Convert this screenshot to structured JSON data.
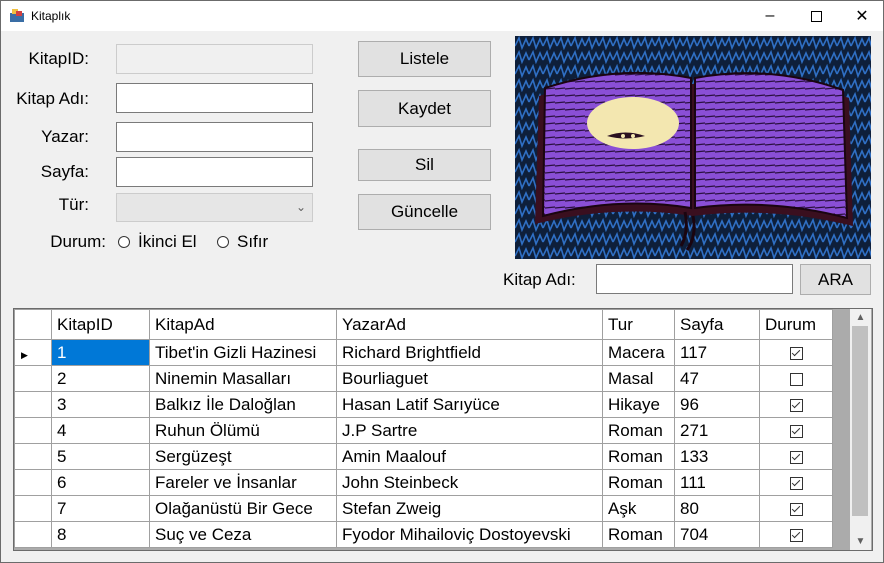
{
  "window": {
    "title": "Kitaplık"
  },
  "form": {
    "labels": {
      "kitapid": "KitapID:",
      "kitap_adi": "Kitap Adı:",
      "yazar": "Yazar:",
      "sayfa": "Sayfa:",
      "tur": "Tür:",
      "durum": "Durum:"
    },
    "values": {
      "kitapid": "",
      "kitap_adi": "",
      "yazar": "",
      "sayfa": "",
      "tur": ""
    },
    "radio": {
      "ikinci_el": "İkinci El",
      "sifir": "Sıfır"
    }
  },
  "buttons": {
    "listele": "Listele",
    "kaydet": "Kaydet",
    "sil": "Sil",
    "guncelle": "Güncelle",
    "ara": "ARA"
  },
  "search": {
    "label": "Kitap Adı:",
    "value": ""
  },
  "grid": {
    "headers": [
      "KitapID",
      "KitapAd",
      "YazarAd",
      "Tur",
      "Sayfa",
      "Durum"
    ],
    "rows": [
      {
        "id": "1",
        "ad": "Tibet'in Gizli Hazinesi",
        "yazar": "Richard Brightfield",
        "tur": "Macera",
        "sayfa": "117",
        "durum": true
      },
      {
        "id": "2",
        "ad": "Ninemin Masalları",
        "yazar": "Bourliaguet",
        "tur": "Masal",
        "sayfa": "47",
        "durum": false
      },
      {
        "id": "3",
        "ad": "Balkız İle Daloğlan",
        "yazar": "Hasan Latif Sarıyüce",
        "tur": "Hikaye",
        "sayfa": "96",
        "durum": true
      },
      {
        "id": "4",
        "ad": "Ruhun Ölümü",
        "yazar": "J.P Sartre",
        "tur": "Roman",
        "sayfa": "271",
        "durum": true
      },
      {
        "id": "5",
        "ad": "Sergüzeşt",
        "yazar": "Amin Maalouf",
        "tur": "Roman",
        "sayfa": "133",
        "durum": true
      },
      {
        "id": "6",
        "ad": "Fareler ve İnsanlar",
        "yazar": "John Steinbeck",
        "tur": "Roman",
        "sayfa": "111",
        "durum": true
      },
      {
        "id": "7",
        "ad": "Olağanüstü Bir Gece",
        "yazar": "Stefan Zweig",
        "tur": "Aşk",
        "sayfa": "80",
        "durum": true
      },
      {
        "id": "8",
        "ad": "Suç ve Ceza",
        "yazar": "Fyodor Mihailoviç Dostoyevski",
        "tur": "Roman",
        "sayfa": "704",
        "durum": true
      }
    ]
  },
  "icons": [
    "app-icon",
    "minimize-icon",
    "maximize-icon",
    "close-icon",
    "chevron-down-icon",
    "row-selector-icon",
    "scroll-up-icon",
    "scroll-down-icon"
  ],
  "colors": {
    "selection": "#0078d7",
    "button": "#e1e1e1",
    "window_bg": "#f0f0f0"
  }
}
